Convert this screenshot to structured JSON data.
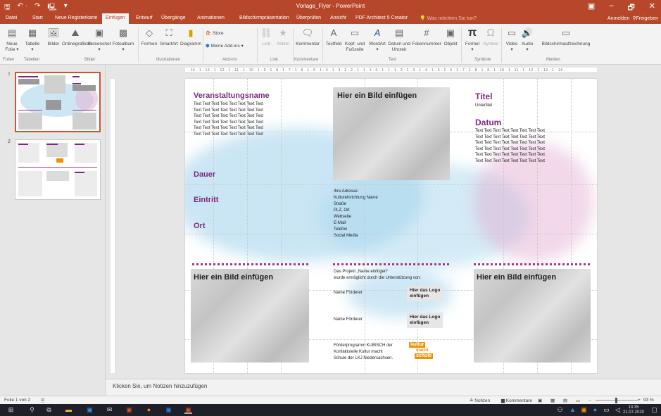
{
  "titlebar": {
    "title": "Vorlage_Flyer - PowerPoint",
    "restore_icon": "▣",
    "minimize_icon": "–",
    "maximize_icon": "🗗",
    "close_icon": "✕"
  },
  "qat": {
    "save_icon": "🖫",
    "undo_icon": "↶ ·",
    "redo_icon": "↷",
    "start_icon": "🖳",
    "more_icon": "▾"
  },
  "tabs": {
    "datei": "Datei",
    "start": "Start",
    "neue": "Neue Registerkarte",
    "einfuegen": "Einfügen",
    "entwurf": "Entwurf",
    "uebergaenge": "Übergänge",
    "animationen": "Animationen",
    "bildschirm": "Bildschirmpräsentation",
    "ueberpruefen": "Überprüfen",
    "ansicht": "Ansicht",
    "pdf": "PDF Architect 5 Creator",
    "tellme": "Was möchten Sie tun?",
    "login": "Anmelden",
    "share": "Freigeben"
  },
  "ribbon": {
    "neue_folie": "Neue\nFolie ▾",
    "tabelle": "Tabelle\n▾",
    "bilder": "Bilder",
    "onlinegrafiken": "Onlinegrafiken",
    "screenshot": "Screenshot\n▾",
    "fotoalbum": "Fotoalbum\n▾",
    "formen": "Formen",
    "smartart": "SmartArt",
    "diagramm": "Diagramm",
    "store": "Store",
    "addins": "Meine Add-ins ▾",
    "link": "Link",
    "aktion": "Aktion",
    "kommentar": "Kommentar",
    "textfeld": "Textfeld",
    "kopf": "Kopf- und\nFußzeile",
    "wordart": "WordArt\n▾",
    "datum": "Datum und\nUhrzeit",
    "foliennummer": "Foliennummer",
    "objekt": "Objekt",
    "formel": "Formel\n▾",
    "symbol": "Symbol",
    "video": "Video\n▾",
    "audio": "Audio\n▾",
    "aufzeichnung": "Bildschirmaufzeichnung",
    "g_folien": "Folien",
    "g_tabellen": "Tabellen",
    "g_bilder": "Bilder",
    "g_illu": "Illustrationen",
    "g_addins": "Add-Ins",
    "g_link": "Link",
    "g_kommentare": "Kommentare",
    "g_text": "Text",
    "g_symbole": "Symbole",
    "g_medien": "Medien",
    "icons": {
      "neue_folie": "▤",
      "tabelle": "▦",
      "bilder": "🖼",
      "online": "⛰",
      "screenshot": "▣",
      "foto": "▩",
      "formen": "◇",
      "smartart": "⛶",
      "diagramm": "▮",
      "store": "🛍",
      "addins": "⬢",
      "link": "⛓",
      "aktion": "★",
      "kommentar": "🗨",
      "textfeld": "A",
      "kopf": "▭",
      "wordart": "A",
      "datum": "▤",
      "nummer": "#",
      "objekt": "▣",
      "formel": "π",
      "symbol": "Ω",
      "video": "▭",
      "audio": "🔊",
      "aufzeichnung": "▭"
    }
  },
  "ruler": {
    "h": "· 14 · 1 · 13 · 1 · 12 · 1 · 11 · 1 · 10 · 1 · 9 · 1 · 8 · 1 · 7 · 1 · 6 · 1 · 5 · 1 · 4 · 1 · 3 · 1 · 2 · 1 · 1 · 1 · 0 · 1 · 1 · 1 · 2 · 1 · 3 · 1 · 4 · 1 · 5 · 1 · 6 · 1 · 7 · 1 · 8 · 1 · 9 · 1 · 10 · 1 · 11 · 1 · 12 · 1 · 13 · 1 · 14 ·"
  },
  "thumbs": [
    {
      "num": "1"
    },
    {
      "num": "2"
    }
  ],
  "slide": {
    "veranstaltungsname": "Veranstaltungsname",
    "textblock_left": [
      "Text Text Text Text Text Text Text Text",
      "Text Text Text Text Text Text Text Text",
      "Text Text Text Text Text Text Text Text",
      "Text Text Text Text Text Text Text Text",
      "Text Text Text Text Text Text Text Text",
      "Text Text Text Text Text Text Text Text"
    ],
    "dauer": "Dauer",
    "eintritt": "Eintritt",
    "ort": "Ort",
    "bild_top": "Hier ein Bild einfügen",
    "bild_left": "Hier ein Bild einfügen",
    "bild_right": "Hier ein Bild einfügen",
    "titel": "Titel",
    "untertitel": "Untertitel",
    "datum": "Datum",
    "textblock_right": [
      "Text Text Text Text Text Text Text Text",
      "Text Text Text Text Text Text Text Text",
      "Text Text Text Text Text Text Text Text",
      "Text Text Text Text Text Text Text Text",
      "Text Text Text Text Text Text Text Text",
      "Text Text Text Text Text Text Text Text"
    ],
    "address": [
      "Ihre Adresse:",
      "Kultureinrichtung Name",
      "Straße",
      "PLZ, Ort",
      "Webseite",
      "E-Mail",
      "Telefon",
      "Social Media"
    ],
    "projekt": [
      "Das Projekt „Name einfügen“",
      "wurde ermöglicht durch die Unterstützung von:"
    ],
    "foerderer1": "Name Förderer",
    "foerderer2": "Name Förderer",
    "logo1": [
      "Hier das Logo",
      "einfügen"
    ],
    "logo2": [
      "Hier das Logo",
      "einfügen"
    ],
    "kubisch": [
      "Förderprogramm KUBISCH der",
      "Kontaktstelle Kultur macht",
      "Schule der LKJ Niedersachsen."
    ],
    "kubisch_logo": [
      "kultur",
      "macht",
      "schule"
    ]
  },
  "notes": "Klicken Sie, um Notizen hinzuzufügen",
  "status": {
    "slide": "Folie 1 von 2",
    "notizen": "≙ Notizen",
    "kommentare": "▆ Kommentare",
    "zoom": "93 %"
  },
  "taskbar": {
    "clock_time": "13:35",
    "clock_date": "21.07.2020"
  }
}
